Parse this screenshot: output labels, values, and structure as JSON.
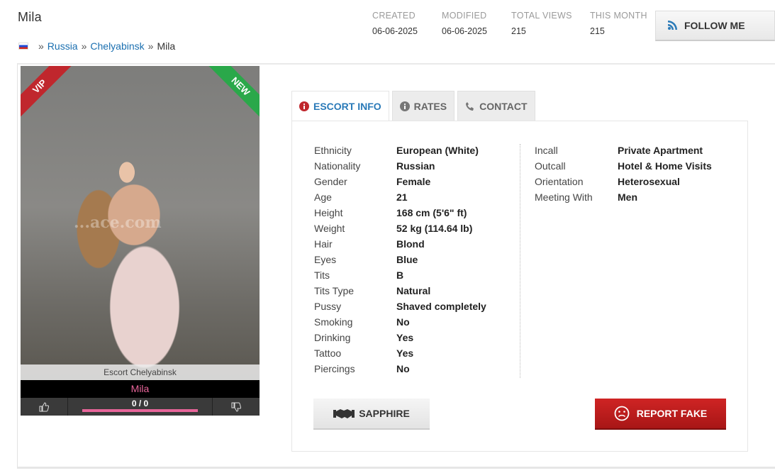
{
  "profile": {
    "name": "Mila"
  },
  "breadcrumb": {
    "country": "Russia",
    "city": "Chelyabinsk",
    "current": "Mila",
    "separator": "»"
  },
  "stats": [
    {
      "label": "CREATED",
      "value": "06-06-2025"
    },
    {
      "label": "MODIFIED",
      "value": "06-06-2025"
    },
    {
      "label": "TOTAL VIEWS",
      "value": "215"
    },
    {
      "label": "THIS MONTH",
      "value": "215"
    }
  ],
  "follow": {
    "label": "FOLLOW ME",
    "icon": "rss-icon"
  },
  "photo": {
    "badge_vip": "VIP",
    "badge_new": "NEW",
    "caption": "Escort Chelyabinsk",
    "watermark": "...ace.com"
  },
  "vote": {
    "name": "Mila",
    "count": "0 / 0",
    "up_icon": "thumbs-up-icon",
    "down_icon": "thumbs-down-icon"
  },
  "tabs": [
    {
      "label": "ESCORT INFO",
      "icon": "info-circle-icon",
      "active": true
    },
    {
      "label": "RATES",
      "icon": "info-circle-icon",
      "active": false
    },
    {
      "label": "CONTACT",
      "icon": "phone-icon",
      "active": false
    }
  ],
  "details_left": [
    {
      "label": "Ethnicity",
      "value": "European (White)"
    },
    {
      "label": "Nationality",
      "value": "Russian"
    },
    {
      "label": "Gender",
      "value": "Female"
    },
    {
      "label": "Age",
      "value": "21"
    },
    {
      "label": "Height",
      "value": "168 cm (5'6\" ft)"
    },
    {
      "label": "Weight",
      "value": "52 kg (114.64 lb)"
    },
    {
      "label": "Hair",
      "value": "Blond"
    },
    {
      "label": "Eyes",
      "value": "Blue"
    },
    {
      "label": "Tits",
      "value": "B"
    },
    {
      "label": "Tits Type",
      "value": "Natural"
    },
    {
      "label": "Pussy",
      "value": "Shaved completely"
    },
    {
      "label": "Smoking",
      "value": "No"
    },
    {
      "label": "Drinking",
      "value": "Yes"
    },
    {
      "label": "Tattoo",
      "value": "Yes"
    },
    {
      "label": "Piercings",
      "value": "No"
    }
  ],
  "details_right": [
    {
      "label": "Incall",
      "value": "Private Apartment"
    },
    {
      "label": "Outcall",
      "value": "Hotel & Home Visits"
    },
    {
      "label": "Orientation",
      "value": "Heterosexual"
    },
    {
      "label": "Meeting With",
      "value": "Men"
    }
  ],
  "buttons": {
    "sapphire": "SAPPHIRE",
    "report": "REPORT FAKE"
  },
  "colors": {
    "accent_blue": "#2a7ab8",
    "vip_red": "#c0272d",
    "new_green": "#2aa84a",
    "name_pink": "#e8659a",
    "report_red": "#c21d1d"
  }
}
